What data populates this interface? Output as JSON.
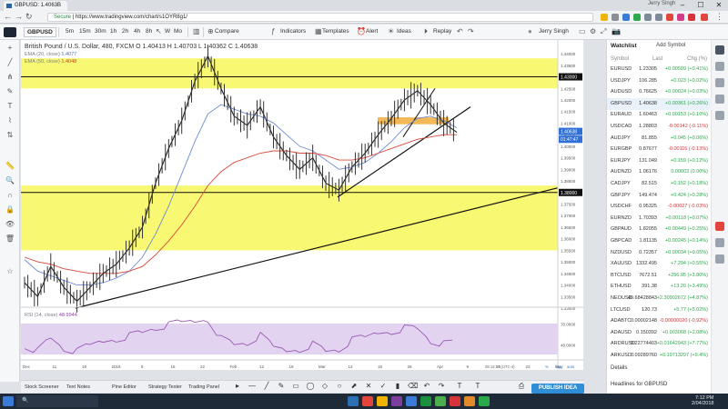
{
  "browser": {
    "tab_title": "GBPUSD: 1.4063B ▲+0...",
    "user": "Jerry Singh",
    "secure_label": "Secure",
    "url": "https://www.tradingview.com/chart/s1OYR8g1/"
  },
  "toolbar": {
    "symbol": "GBPUSD",
    "intervals": [
      "5m",
      "15m",
      "30m",
      "1h",
      "2h",
      "4h",
      "8h"
    ],
    "btn_w": "W",
    "btn_mo": "Mo",
    "compare": "Compare",
    "indicators": "Indicators",
    "templates": "Templates",
    "alert": "Alert",
    "ideas": "Ideas",
    "replay": "Replay",
    "user": "Jerry Singh"
  },
  "chart": {
    "title": "British Pound / U.S. Dollar, 480, FXCM",
    "ohlc": "O 1.40413  H 1.40703  L 1.40362  C 1.40638",
    "ema20_label": "EMA (20, close)",
    "ema20_val": "1.4077",
    "ema50_label": "EMA (50, close)",
    "ema50_val": "1.4048",
    "rsi_label": "RSI (14, close)",
    "rsi_val": "48.9944",
    "price_ticks": [
      "1.44000",
      "1.43500",
      "1.43000",
      "1.42500",
      "1.42000",
      "1.41500",
      "1.41000",
      "1.40500",
      "1.40000",
      "1.39500",
      "1.39000",
      "1.38500",
      "1.38000",
      "1.37500",
      "1.37000",
      "1.36500",
      "1.36000",
      "1.35500",
      "1.35000",
      "1.34500",
      "1.34000",
      "1.33500",
      "1.33000"
    ],
    "last_price_tag": "1.40638",
    "time_tag": "01:47:47",
    "level_upper": "1.43000",
    "level_lower": "1.38000",
    "time_ticks": [
      "Dec",
      "11",
      "18",
      "2018",
      "8",
      "15",
      "22",
      "Feb",
      "12",
      "19",
      "Mar",
      "12",
      "19",
      "26",
      "Apr",
      "9",
      "16",
      "23",
      "May"
    ],
    "rsi_ticks": [
      "70.0000",
      "48.0000"
    ],
    "bottom_time": "05:13:17 (UTC-4)",
    "bottom_modes": [
      "%",
      "log",
      "auto"
    ]
  },
  "chart_data": {
    "type": "line",
    "series": [
      {
        "name": "GBPUSD",
        "values": [
          1.341,
          1.335,
          1.348,
          1.339,
          1.333,
          1.339,
          1.345,
          1.349,
          1.356,
          1.365,
          1.384,
          1.399,
          1.411,
          1.428,
          1.439,
          1.425,
          1.413,
          1.409,
          1.417,
          1.404,
          1.396,
          1.39,
          1.395,
          1.384,
          1.381,
          1.391,
          1.397,
          1.405,
          1.412,
          1.42,
          1.424,
          1.418,
          1.41,
          1.406
        ]
      },
      {
        "name": "EMA (20, close)",
        "values": [
          1.351,
          1.346,
          1.344,
          1.342,
          1.34,
          1.34,
          1.341,
          1.343,
          1.346,
          1.352,
          1.362,
          1.374,
          1.388,
          1.402,
          1.414,
          1.418,
          1.416,
          1.414,
          1.413,
          1.41,
          1.405,
          1.4,
          1.398,
          1.394,
          1.39,
          1.391,
          1.393,
          1.397,
          1.402,
          1.408,
          1.412,
          1.413,
          1.411,
          1.408
        ]
      },
      {
        "name": "EMA (50, close)",
        "values": [
          1.352,
          1.35,
          1.349,
          1.347,
          1.346,
          1.345,
          1.345,
          1.345,
          1.346,
          1.348,
          1.353,
          1.359,
          1.366,
          1.374,
          1.383,
          1.389,
          1.393,
          1.395,
          1.397,
          1.398,
          1.398,
          1.397,
          1.397,
          1.396,
          1.394,
          1.394,
          1.395,
          1.397,
          1.399,
          1.401,
          1.403,
          1.404,
          1.405,
          1.405
        ]
      },
      {
        "name": "RSI (14, close)",
        "values": [
          48,
          42,
          55,
          44,
          40,
          47,
          52,
          55,
          58,
          61,
          66,
          68,
          71,
          73,
          76,
          55,
          48,
          50,
          57,
          45,
          42,
          44,
          49,
          41,
          43,
          52,
          55,
          61,
          63,
          66,
          65,
          52,
          48,
          49
        ]
      }
    ],
    "ylim": [
      1.33,
      1.442
    ],
    "rsi_ylim": [
      30,
      80
    ],
    "horizontal_levels": [
      1.43,
      1.38
    ],
    "zones": [
      [
        1.425,
        1.438
      ],
      [
        1.355,
        1.383
      ]
    ],
    "legend_position": "top-left"
  },
  "drawing_tools": [
    "cursor",
    "crosshair",
    "trend-line",
    "brush",
    "text",
    "ruler",
    "zoom",
    "magnet",
    "lock",
    "eye",
    "trash"
  ],
  "bottom_tabs": [
    "Stock Screener",
    "Text Notes",
    "Pine Editor",
    "Strategy Tester",
    "Trading Panel"
  ],
  "publish_label": "PUBLISH IDEA",
  "watchlist": {
    "title": "Watchlist",
    "add_label": "Add Symbol",
    "col_symbol": "Symbol",
    "col_last": "Last",
    "col_chg": "Chg (%)",
    "rows": [
      {
        "sym": "EURUSD",
        "last": "1.23305",
        "chg": "+0.00509 (+0.41%)",
        "dir": "pos"
      },
      {
        "sym": "USDJPY",
        "last": "106.285",
        "chg": "+0.023 (+0.02%)",
        "dir": "pos"
      },
      {
        "sym": "AUDUSD",
        "last": "0.76625",
        "chg": "+0.00024 (+0.03%)",
        "dir": "pos"
      },
      {
        "sym": "GBPUSD",
        "last": "1.40638",
        "chg": "+0.00361 (+0.26%)",
        "dir": "pos"
      },
      {
        "sym": "EURAUD",
        "last": "1.60463",
        "chg": "+0.00153 (+0.10%)",
        "dir": "pos"
      },
      {
        "sym": "USDCAD",
        "last": "1.28803",
        "chg": "-0.00142 (-0.11%)",
        "dir": "neg"
      },
      {
        "sym": "AUDJPY",
        "last": "81.855",
        "chg": "+0.045 (+0.06%)",
        "dir": "pos"
      },
      {
        "sym": "EURGBP",
        "last": "0.87677",
        "chg": "-0.00116 (-0.13%)",
        "dir": "neg"
      },
      {
        "sym": "EURJPY",
        "last": "131.049",
        "chg": "+0.159 (+0.12%)",
        "dir": "pos"
      },
      {
        "sym": "AUDNZD",
        "last": "1.06176",
        "chg": "0.00003 (0.00%)",
        "dir": "pos"
      },
      {
        "sym": "CADJPY",
        "last": "82.515",
        "chg": "+0.152 (+0.18%)",
        "dir": "pos"
      },
      {
        "sym": "GBPJPY",
        "last": "149.474",
        "chg": "+0.424 (+0.28%)",
        "dir": "pos"
      },
      {
        "sym": "USDCHF",
        "last": "0.95325",
        "chg": "-0.00027 (-0.03%)",
        "dir": "neg"
      },
      {
        "sym": "EURNZD",
        "last": "1.70393",
        "chg": "+0.00118 (+0.07%)",
        "dir": "pos"
      },
      {
        "sym": "GBPAUD",
        "last": "1.82055",
        "chg": "+0.00449 (+0.25%)",
        "dir": "pos"
      },
      {
        "sym": "GBPCAD",
        "last": "1.81135",
        "chg": "+0.00245 (+0.14%)",
        "dir": "pos"
      },
      {
        "sym": "NZDUSD",
        "last": "0.72357",
        "chg": "+0.00034 (+0.05%)",
        "dir": "pos"
      },
      {
        "sym": "XAUUSD",
        "last": "1332.495",
        "chg": "+7.294 (+0.55%)",
        "dir": "pos"
      },
      {
        "sym": "BTCUSD",
        "last": "7672.51",
        "chg": "+256.95 (+3.80%)",
        "dir": "pos"
      },
      {
        "sym": "ETHUSD",
        "last": "391.38",
        "chg": "+13.20 (+3.49%)",
        "dir": "pos"
      },
      {
        "sym": "NEOUSD",
        "last": "49.68428843",
        "chg": "+2.30902672 (+4.87%)",
        "dir": "pos"
      },
      {
        "sym": "LTCUSD",
        "last": "120.73",
        "chg": "+5.77 (+5.02%)",
        "dir": "pos"
      },
      {
        "sym": "ADABTC",
        "last": "0.00002148",
        "chg": "-0.00000020 (-0.92%)",
        "dir": "neg"
      },
      {
        "sym": "ADAUSD",
        "last": "0.150392",
        "chg": "+0.003068 (+2.08%)",
        "dir": "pos"
      },
      {
        "sym": "ARDRUSD",
        "last": "0.22774403",
        "chg": "+0.01642943 (+7.77%)",
        "dir": "pos"
      },
      {
        "sym": "ARKUSD",
        "last": "0.09289760",
        "chg": "+0.19713297 (+9.4%)",
        "dir": "pos"
      }
    ],
    "details": "Details",
    "headlines": "Headlines for GBPUSD"
  },
  "taskbar": {
    "time": "7:12 PM",
    "date": "2/04/2018"
  },
  "colors": {
    "zone_yellow": "#f7f75a",
    "ema_blue": "#6c8ad4",
    "ema_red": "#d9483b",
    "rsi_purple": "#9b59b6",
    "publish_blue": "#2f8fd6"
  }
}
